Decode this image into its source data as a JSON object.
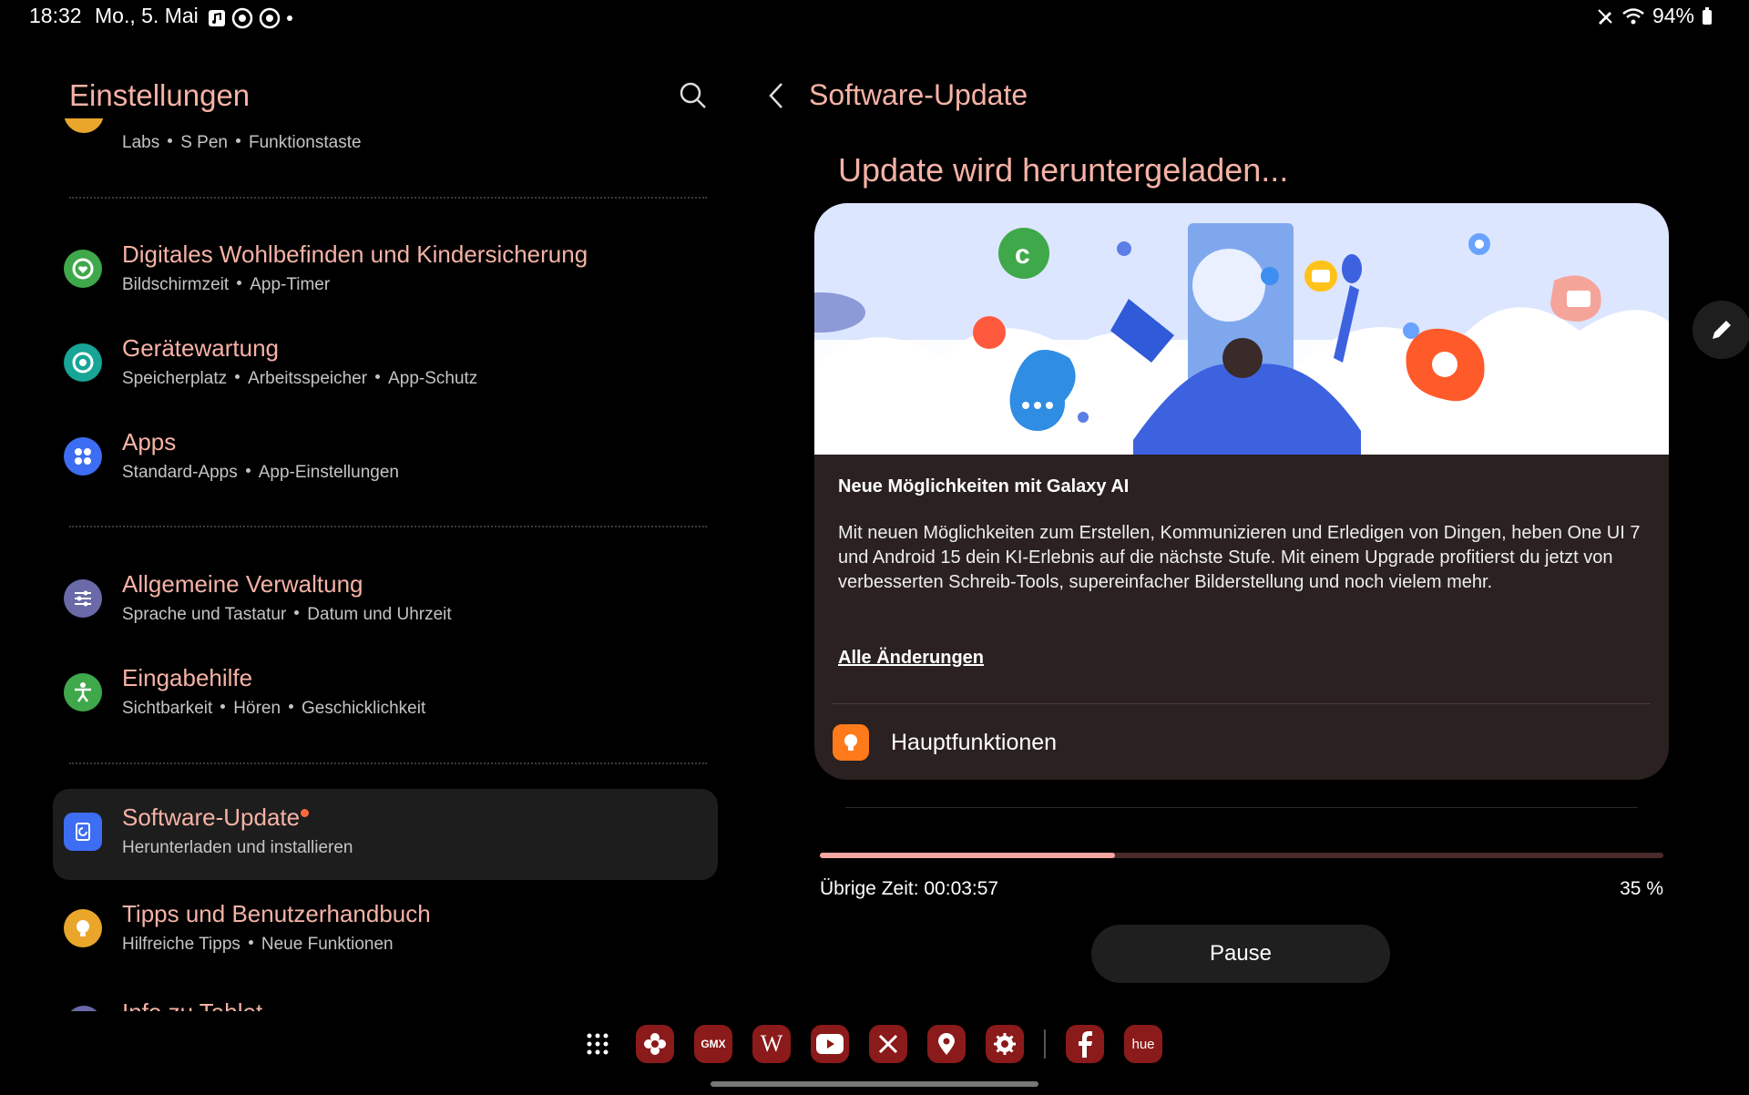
{
  "status_bar": {
    "time": "18:32",
    "date": "Mo., 5. Mai",
    "battery": "94%"
  },
  "left": {
    "title": "Einstellungen",
    "partial_top_sub": [
      "Labs",
      "S Pen",
      "Funktionstaste"
    ],
    "items": [
      {
        "title": "Digitales Wohlbefinden und Kindersicherung",
        "sub": [
          "Bildschirmzeit",
          "App-Timer"
        ],
        "icon": "wellbeing-icon",
        "color": "#3fa84a"
      },
      {
        "title": "Gerätewartung",
        "sub": [
          "Speicherplatz",
          "Arbeitsspeicher",
          "App-Schutz"
        ],
        "icon": "device-care-icon",
        "color": "#17a596"
      },
      {
        "title": "Apps",
        "sub": [
          "Standard-Apps",
          "App-Einstellungen"
        ],
        "icon": "apps-icon",
        "color": "#3d6df2"
      },
      {
        "title": "Allgemeine Verwaltung",
        "sub": [
          "Sprache und Tastatur",
          "Datum und Uhrzeit"
        ],
        "icon": "general-management-icon",
        "color": "#6a6aa8"
      },
      {
        "title": "Eingabehilfe",
        "sub": [
          "Sichtbarkeit",
          "Hören",
          "Geschicklichkeit"
        ],
        "icon": "accessibility-icon",
        "color": "#3fa84a"
      },
      {
        "title": "Software-Update",
        "sub": [
          "Herunterladen und installieren"
        ],
        "icon": "software-update-icon",
        "color": "#3d6df2"
      },
      {
        "title": "Tipps und Benutzerhandbuch",
        "sub": [
          "Hilfreiche Tipps",
          "Neue Funktionen"
        ],
        "icon": "tips-icon",
        "color": "#e9a62b"
      }
    ],
    "partial_bottom_title": "Info zu Tablet"
  },
  "right": {
    "title": "Software-Update",
    "heading": "Update wird heruntergeladen...",
    "card": {
      "heading": "Neue Möglichkeiten mit Galaxy AI",
      "body": "Mit neuen Möglichkeiten zum Erstellen, Kommunizieren und Erledigen von Dingen, heben One UI 7 und Android 15 dein KI-Erlebnis auf die nächste Stufe. Mit einem Upgrade profitierst du jetzt von verbesserten Schreib-Tools, supereinfacher Bilderstellung und noch vielem mehr.",
      "link": "Alle Änderungen",
      "feature_label": "Hauptfunktionen"
    },
    "progress": {
      "percent": 35,
      "remaining": "Übrige Zeit: 00:03:57",
      "percent_label": "35 %"
    },
    "pause_label": "Pause"
  },
  "dock": {
    "apps": [
      "GMX",
      "W",
      "hue"
    ]
  },
  "colors": {
    "accent": "#f6b2a6",
    "progress_track": "#4a2a2a",
    "progress_fill": "#f4a6a0",
    "dock_tile": "#8b1a1a"
  }
}
